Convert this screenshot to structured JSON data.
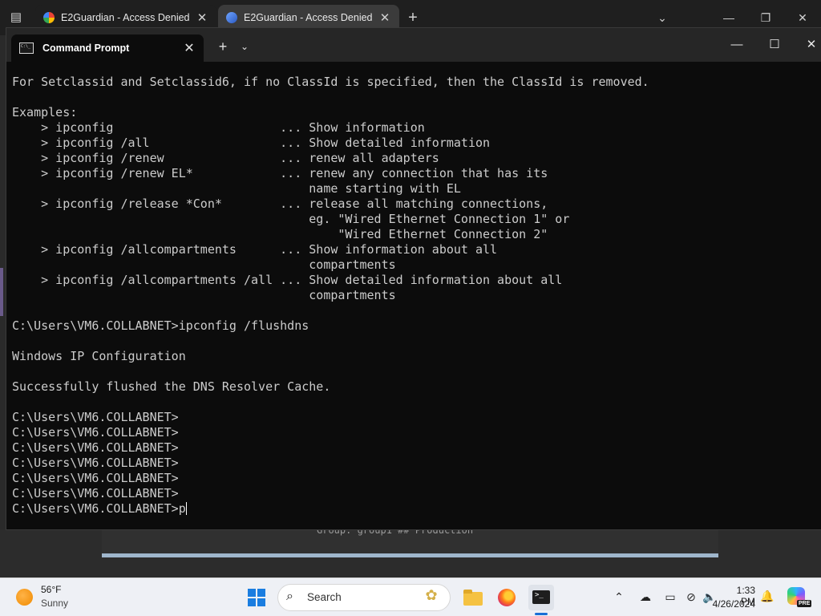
{
  "browser": {
    "tabs": [
      {
        "title": "E2Guardian - Access Denied",
        "active": false,
        "favicon": "google-icon"
      },
      {
        "title": "E2Guardian - Access Denied",
        "active": true,
        "favicon": "edge-icon"
      }
    ],
    "new_tab_glyph": "+",
    "tab_list_glyph": "⌄",
    "controls": {
      "minimize": "—",
      "restore": "❐",
      "close": "✕"
    }
  },
  "background_page": {
    "dialog_text": "Group: group1 ## Production"
  },
  "terminal": {
    "tab_title": "Command Prompt",
    "tab_close_glyph": "✕",
    "new_tab_glyph": "+",
    "dropdown_glyph": "⌄",
    "controls": {
      "minimize": "—",
      "maximize": "☐",
      "close": "✕"
    },
    "lines": [
      "For Setclassid and Setclassid6, if no ClassId is specified, then the ClassId is removed.",
      "",
      "Examples:",
      "    > ipconfig                       ... Show information",
      "    > ipconfig /all                  ... Show detailed information",
      "    > ipconfig /renew                ... renew all adapters",
      "    > ipconfig /renew EL*            ... renew any connection that has its",
      "                                         name starting with EL",
      "    > ipconfig /release *Con*        ... release all matching connections,",
      "                                         eg. \"Wired Ethernet Connection 1\" or",
      "                                             \"Wired Ethernet Connection 2\"",
      "    > ipconfig /allcompartments      ... Show information about all",
      "                                         compartments",
      "    > ipconfig /allcompartments /all ... Show detailed information about all",
      "                                         compartments",
      "",
      "C:\\Users\\VM6.COLLABNET>ipconfig /flushdns",
      "",
      "Windows IP Configuration",
      "",
      "Successfully flushed the DNS Resolver Cache.",
      "",
      "C:\\Users\\VM6.COLLABNET>",
      "C:\\Users\\VM6.COLLABNET>",
      "C:\\Users\\VM6.COLLABNET>",
      "C:\\Users\\VM6.COLLABNET>",
      "C:\\Users\\VM6.COLLABNET>",
      "C:\\Users\\VM6.COLLABNET>"
    ],
    "prompt_line": "C:\\Users\\VM6.COLLABNET>p"
  },
  "taskbar": {
    "weather": {
      "temp": "56°F",
      "condition": "Sunny"
    },
    "search_label": "Search",
    "search_icon": "⌕",
    "search_deco": "✿",
    "tray": {
      "chevron": "⌃",
      "onedrive": "☁",
      "display": "▭",
      "network": "⊘",
      "volume": "🔈"
    },
    "clock": {
      "time": "1:33 PM",
      "date": "4/26/2024"
    },
    "bell": "🔔",
    "copilot_badge": "PRE"
  }
}
